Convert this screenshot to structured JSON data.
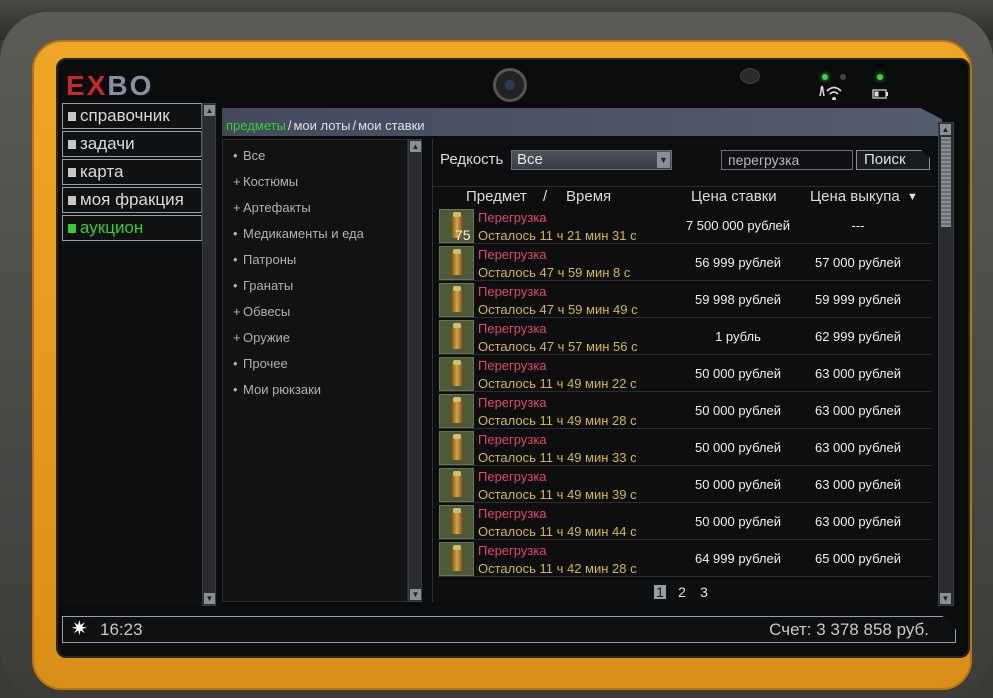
{
  "logo": {
    "part1": "E",
    "part2": "X",
    "part3": "BO"
  },
  "menu": {
    "items": [
      {
        "label": "справочник",
        "active": false
      },
      {
        "label": "задачи",
        "active": false
      },
      {
        "label": "карта",
        "active": false
      },
      {
        "label": "моя фракция",
        "active": false
      },
      {
        "label": "аукцион",
        "active": true
      }
    ]
  },
  "tabs": [
    {
      "label": "предметы",
      "active": true
    },
    {
      "label": "мои лоты",
      "active": false
    },
    {
      "label": "мои ставки",
      "active": false
    }
  ],
  "tab_separator": "/",
  "categories": [
    {
      "bullet": "•",
      "label": "Все"
    },
    {
      "bullet": "+",
      "label": "Костюмы"
    },
    {
      "bullet": "+",
      "label": "Артефакты"
    },
    {
      "bullet": "•",
      "label": "Медикаменты и еда"
    },
    {
      "bullet": "•",
      "label": "Патроны"
    },
    {
      "bullet": "•",
      "label": "Гранаты"
    },
    {
      "bullet": "+",
      "label": "Обвесы"
    },
    {
      "bullet": "+",
      "label": "Оружие"
    },
    {
      "bullet": "•",
      "label": "Прочее"
    },
    {
      "bullet": "•",
      "label": "Мои рюкзаки"
    }
  ],
  "filter": {
    "rarity_label": "Редкость",
    "rarity_value": "Все",
    "search_value": "перегрузка",
    "search_button": "Поиск"
  },
  "table": {
    "headers": {
      "item": "Предмет",
      "slash": "/",
      "time": "Время",
      "bid": "Цена ставки",
      "buyout": "Цена выкупа",
      "sort_arrow": "▼"
    },
    "rows": [
      {
        "qty": "75",
        "name": "Перегрузка",
        "time": "Осталось 11 ч 21 мин 31 с",
        "bid": "7 500 000 рублей",
        "buyout": "---"
      },
      {
        "qty": "",
        "name": "Перегрузка",
        "time": "Осталось 47 ч 59 мин 8 с",
        "bid": "56 999 рублей",
        "buyout": "57 000 рублей"
      },
      {
        "qty": "",
        "name": "Перегрузка",
        "time": "Осталось 47 ч 59 мин 49 с",
        "bid": "59 998 рублей",
        "buyout": "59 999 рублей"
      },
      {
        "qty": "",
        "name": "Перегрузка",
        "time": "Осталось 47 ч 57 мин 56 с",
        "bid": "1 рубль",
        "buyout": "62 999 рублей"
      },
      {
        "qty": "",
        "name": "Перегрузка",
        "time": "Осталось 11 ч 49 мин 22 с",
        "bid": "50 000 рублей",
        "buyout": "63 000 рублей"
      },
      {
        "qty": "",
        "name": "Перегрузка",
        "time": "Осталось 11 ч 49 мин 28 с",
        "bid": "50 000 рублей",
        "buyout": "63 000 рублей"
      },
      {
        "qty": "",
        "name": "Перегрузка",
        "time": "Осталось 11 ч 49 мин 33 с",
        "bid": "50 000 рублей",
        "buyout": "63 000 рублей"
      },
      {
        "qty": "",
        "name": "Перегрузка",
        "time": "Осталось 11 ч 49 мин 39 с",
        "bid": "50 000 рублей",
        "buyout": "63 000 рублей"
      },
      {
        "qty": "",
        "name": "Перегрузка",
        "time": "Осталось 11 ч 49 мин 44 с",
        "bid": "50 000 рублей",
        "buyout": "63 000 рублей"
      },
      {
        "qty": "",
        "name": "Перегрузка",
        "time": "Осталось 11 ч 42 мин 28 с",
        "bid": "64 999 рублей",
        "buyout": "65 000 рублей"
      }
    ]
  },
  "pagination": {
    "pages": [
      "1",
      "2",
      "3"
    ],
    "current": "1"
  },
  "footer": {
    "time": "16:23",
    "balance": "Счет: 3 378 858 руб."
  },
  "icons": {
    "sun": "✷",
    "antenna": "📡",
    "battery": "▭"
  },
  "colors": {
    "accent_green": "#33d033",
    "item_name": "#e2486a",
    "time_left": "#d6b93a",
    "frame_yellow": "#f0a625"
  }
}
